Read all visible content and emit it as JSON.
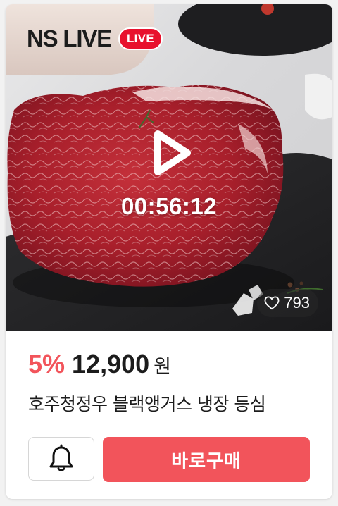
{
  "brand": {
    "name": "NS LIVE",
    "badge": "LIVE",
    "badge_color": "#e8112d"
  },
  "video": {
    "timer": "00:56:12",
    "play_icon": "play-icon",
    "likes_icon": "heart-outline-icon",
    "likes_count": "793"
  },
  "product": {
    "discount": "5%",
    "price": "12,900",
    "currency": "원",
    "title": "호주청정우 블랙앵거스 냉장 등심"
  },
  "actions": {
    "alarm_icon": "bell-icon",
    "buy_label": "바로구매",
    "accent_color": "#f2545b"
  }
}
